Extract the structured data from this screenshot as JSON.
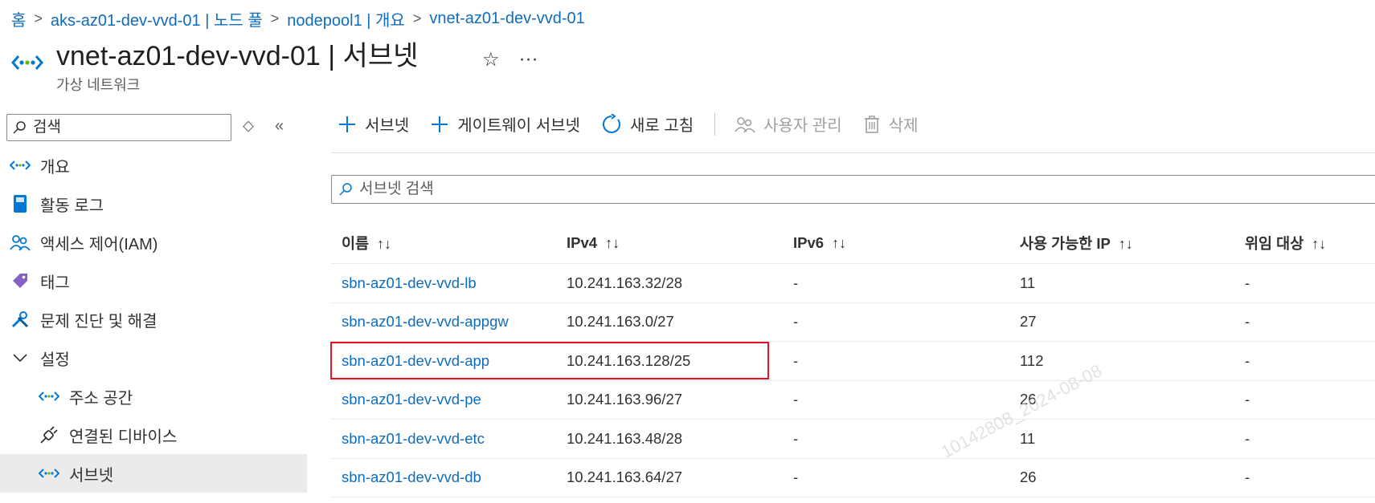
{
  "breadcrumb": [
    "홈",
    "aks-az01-dev-vvd-01 | 노드 풀",
    "nodepool1 | 개요",
    "vnet-az01-dev-vvd-01"
  ],
  "header": {
    "title": "vnet-az01-dev-vvd-01 | 서브넷",
    "subtitle": "가상 네트워크",
    "favorite_icon": "star-icon",
    "more_label": "···"
  },
  "sidebar": {
    "search_placeholder": "검색",
    "items": [
      {
        "label": "개요",
        "icon": "vnet-icon"
      },
      {
        "label": "활동 로그",
        "icon": "log-book-icon"
      },
      {
        "label": "액세스 제어(IAM)",
        "icon": "people-icon"
      },
      {
        "label": "태그",
        "icon": "tag-icon"
      },
      {
        "label": "문제 진단 및 해결",
        "icon": "tools-icon"
      },
      {
        "label": "설정",
        "icon": "chevron-down-icon"
      },
      {
        "label": "주소 공간",
        "icon": "vnet-icon"
      },
      {
        "label": "연결된 디바이스",
        "icon": "plug-icon"
      },
      {
        "label": "서브넷",
        "icon": "vnet-icon"
      }
    ]
  },
  "toolbar": {
    "add_subnet": "서브넷",
    "add_gateway_subnet": "게이트웨이 서브넷",
    "refresh": "새로 고침",
    "manage_users": "사용자 관리",
    "delete": "삭제"
  },
  "filter": {
    "placeholder": "서브넷 검색"
  },
  "table": {
    "headers": [
      "이름",
      "IPv4",
      "IPv6",
      "사용 가능한 IP",
      "위임 대상"
    ],
    "sort_glyph": "↑↓",
    "rows": [
      {
        "name": "sbn-az01-dev-vvd-lb",
        "ipv4": "10.241.163.32/28",
        "ipv6": "-",
        "available": "11",
        "delegated": "-"
      },
      {
        "name": "sbn-az01-dev-vvd-appgw",
        "ipv4": "10.241.163.0/27",
        "ipv6": "-",
        "available": "27",
        "delegated": "-"
      },
      {
        "name": "sbn-az01-dev-vvd-app",
        "ipv4": "10.241.163.128/25",
        "ipv6": "-",
        "available": "112",
        "delegated": "-"
      },
      {
        "name": "sbn-az01-dev-vvd-pe",
        "ipv4": "10.241.163.96/27",
        "ipv6": "-",
        "available": "26",
        "delegated": "-"
      },
      {
        "name": "sbn-az01-dev-vvd-etc",
        "ipv4": "10.241.163.48/28",
        "ipv6": "-",
        "available": "11",
        "delegated": "-"
      },
      {
        "name": "sbn-az01-dev-vvd-db",
        "ipv4": "10.241.163.64/27",
        "ipv6": "-",
        "available": "26",
        "delegated": "-"
      }
    ]
  },
  "watermark": "10142808_2024-08-08",
  "colors": {
    "link": "#0f6cbd",
    "highlight": "#e81123",
    "active_bg": "#edebe9"
  }
}
